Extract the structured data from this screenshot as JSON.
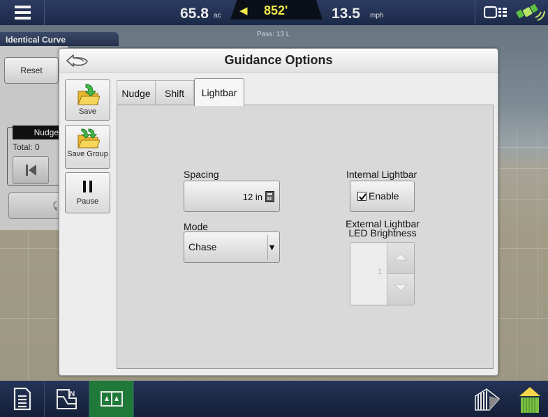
{
  "top_bar": {
    "area_value": "65.8",
    "area_unit": "ac",
    "offline_value": "852'",
    "offline_arrow": "◀",
    "speed_value": "13.5",
    "speed_unit": "mph",
    "pass_text": "Pass: 13 L",
    "icons": [
      "menu-icon",
      "display-status-icon",
      "gps-satellite-icon"
    ]
  },
  "left_panel": {
    "tab_title": "Identical Curve",
    "reset_label": "Reset",
    "nudge_header": "Nudge",
    "nudge_total": "Total: 0",
    "icons": [
      "skip-left-icon",
      "shift-icon"
    ]
  },
  "dialog": {
    "title": "Guidance Options",
    "back_icon": "back-arrow-icon",
    "side_buttons": [
      {
        "label": "Save",
        "icon": "save-folder-icon"
      },
      {
        "label": "Save Group",
        "icon": "save-group-folder-icon"
      },
      {
        "label": "Pause",
        "icon": "pause-icon"
      }
    ],
    "tabs": [
      {
        "label": "Nudge",
        "active": false
      },
      {
        "label": "Shift",
        "active": false
      },
      {
        "label": "Lightbar",
        "active": true
      }
    ],
    "lightbar": {
      "spacing_label": "Spacing",
      "spacing_value": "12 in",
      "mode_label": "Mode",
      "mode_value": "Chase",
      "internal_label": "Internal Lightbar",
      "enable_label": "Enable",
      "enable_checked": true,
      "external_label_line1": "External Lightbar",
      "external_label_line2": "LED Brightness",
      "brightness_value": "1",
      "brightness_enabled": false
    }
  },
  "bottom_bar": {
    "icons": [
      "report-icon",
      "map-icon",
      "split-screen-icon",
      "implement-icon",
      "bin-icon"
    ],
    "active_color": "#1f7a3a"
  }
}
